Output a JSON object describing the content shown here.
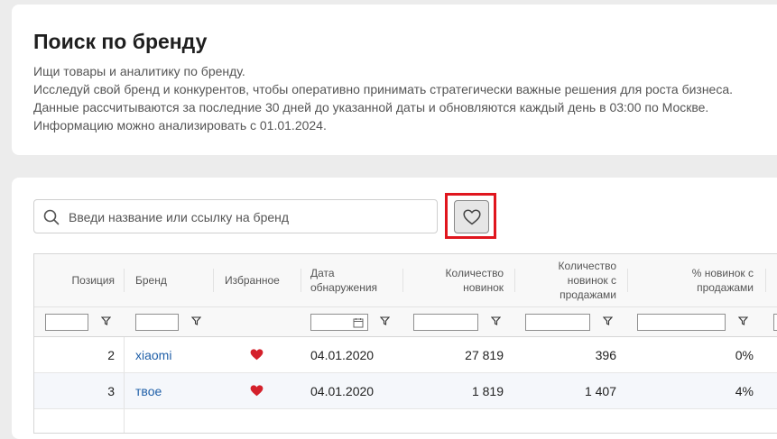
{
  "header": {
    "title": "Поиск по бренду",
    "description": [
      "Ищи товары и аналитику по бренду.",
      "Исследуй свой бренд и конкурентов, чтобы оперативно принимать стратегически важные решения для роста бизнеса.",
      "Данные рассчитываются за последние 30 дней до указанной даты и обновляются каждый день в 03:00 по Москве.",
      "Информацию можно анализировать с 01.01.2024."
    ]
  },
  "search": {
    "placeholder": "Введи название или ссылку на бренд",
    "value": ""
  },
  "favorites_toggle": {
    "icon": "heart-outline-icon",
    "highlight_color": "#e0161e"
  },
  "table": {
    "columns": [
      "Позиция",
      "Бренд",
      "Избранное",
      "Дата обнаружения",
      "Количество новинок",
      "Количество новинок с продажами",
      "% новинок с продажами"
    ],
    "rows": [
      {
        "position": "2",
        "brand": "xiaomi",
        "favorite": true,
        "date": "04.01.2020",
        "new_items": "27 819",
        "new_with_sales": "396",
        "pct_with_sales": "0%"
      },
      {
        "position": "3",
        "brand": "твое",
        "favorite": true,
        "date": "04.01.2020",
        "new_items": "1 819",
        "new_with_sales": "1 407",
        "pct_with_sales": "4%"
      }
    ]
  },
  "colors": {
    "link": "#1f5fa8",
    "heart": "#d4202b",
    "page_bg": "#ececec"
  }
}
